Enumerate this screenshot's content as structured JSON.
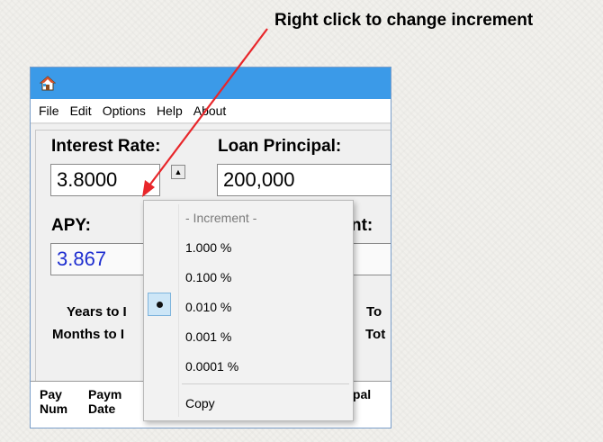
{
  "annotation": {
    "text": "Right click to change increment"
  },
  "menubar": {
    "items": [
      "File",
      "Edit",
      "Options",
      "Help",
      "About"
    ]
  },
  "fields": {
    "interest_rate": {
      "label": "Interest Rate:",
      "value": "3.8000"
    },
    "loan_principal": {
      "label": "Loan Principal:",
      "value": "200,000"
    },
    "apy": {
      "label": "APY:",
      "value": "3.867"
    },
    "payment_label_partial": "nt:"
  },
  "summary": {
    "years_partial": "Years to I",
    "months_partial": "Months to I",
    "total1_partial": "To",
    "total2_partial": "Tot"
  },
  "table": {
    "headers": [
      {
        "line1": "Pay",
        "line2": "Num"
      },
      {
        "line1": "Paym",
        "line2": "Date"
      },
      {
        "line1": "",
        "line2": "ipal"
      }
    ]
  },
  "context_menu": {
    "header": "- Increment -",
    "items": [
      "1.000 %",
      "0.100 %",
      "0.010 %",
      "0.001 %",
      "0.0001 %"
    ],
    "selected_index": 2,
    "copy_label": "Copy"
  },
  "colors": {
    "titlebar": "#3b9ae8",
    "apy_value": "#1f2fd0",
    "arrow": "#e8262a"
  }
}
